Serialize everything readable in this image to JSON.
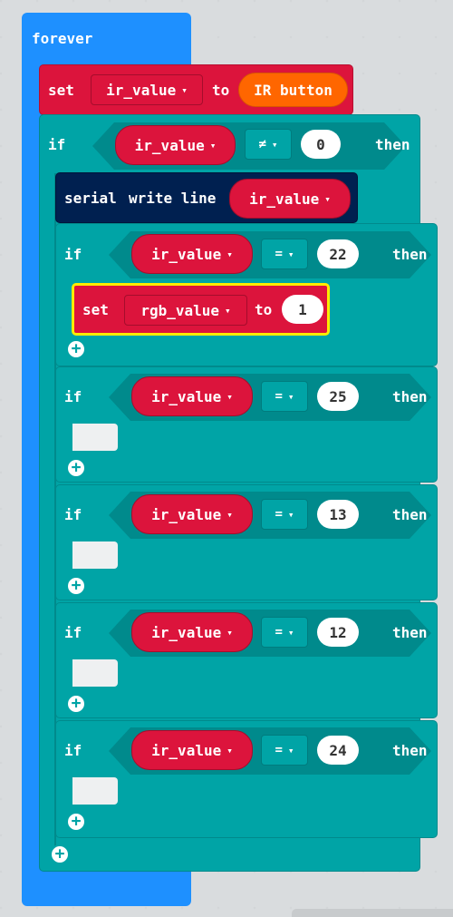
{
  "forever_label": "forever",
  "set_ir": {
    "set": "set",
    "variable": "ir_value",
    "to": "to",
    "value": "IR button"
  },
  "outer_if": {
    "if": "if",
    "variable": "ir_value",
    "operator": "≠",
    "value": "0",
    "then": "then"
  },
  "serial": {
    "label1": "serial",
    "label2": "write line",
    "variable": "ir_value"
  },
  "inner_ifs": [
    {
      "if": "if",
      "variable": "ir_value",
      "operator": "=",
      "value": "22",
      "then": "then"
    },
    {
      "if": "if",
      "variable": "ir_value",
      "operator": "=",
      "value": "25",
      "then": "then"
    },
    {
      "if": "if",
      "variable": "ir_value",
      "operator": "=",
      "value": "13",
      "then": "then"
    },
    {
      "if": "if",
      "variable": "ir_value",
      "operator": "=",
      "value": "12",
      "then": "then"
    },
    {
      "if": "if",
      "variable": "ir_value",
      "operator": "=",
      "value": "24",
      "then": "then"
    }
  ],
  "set_rgb": {
    "set": "set",
    "variable": "rgb_value",
    "to": "to",
    "value": "1"
  },
  "dropdown_glyph": "▾",
  "plus_glyph": "+"
}
